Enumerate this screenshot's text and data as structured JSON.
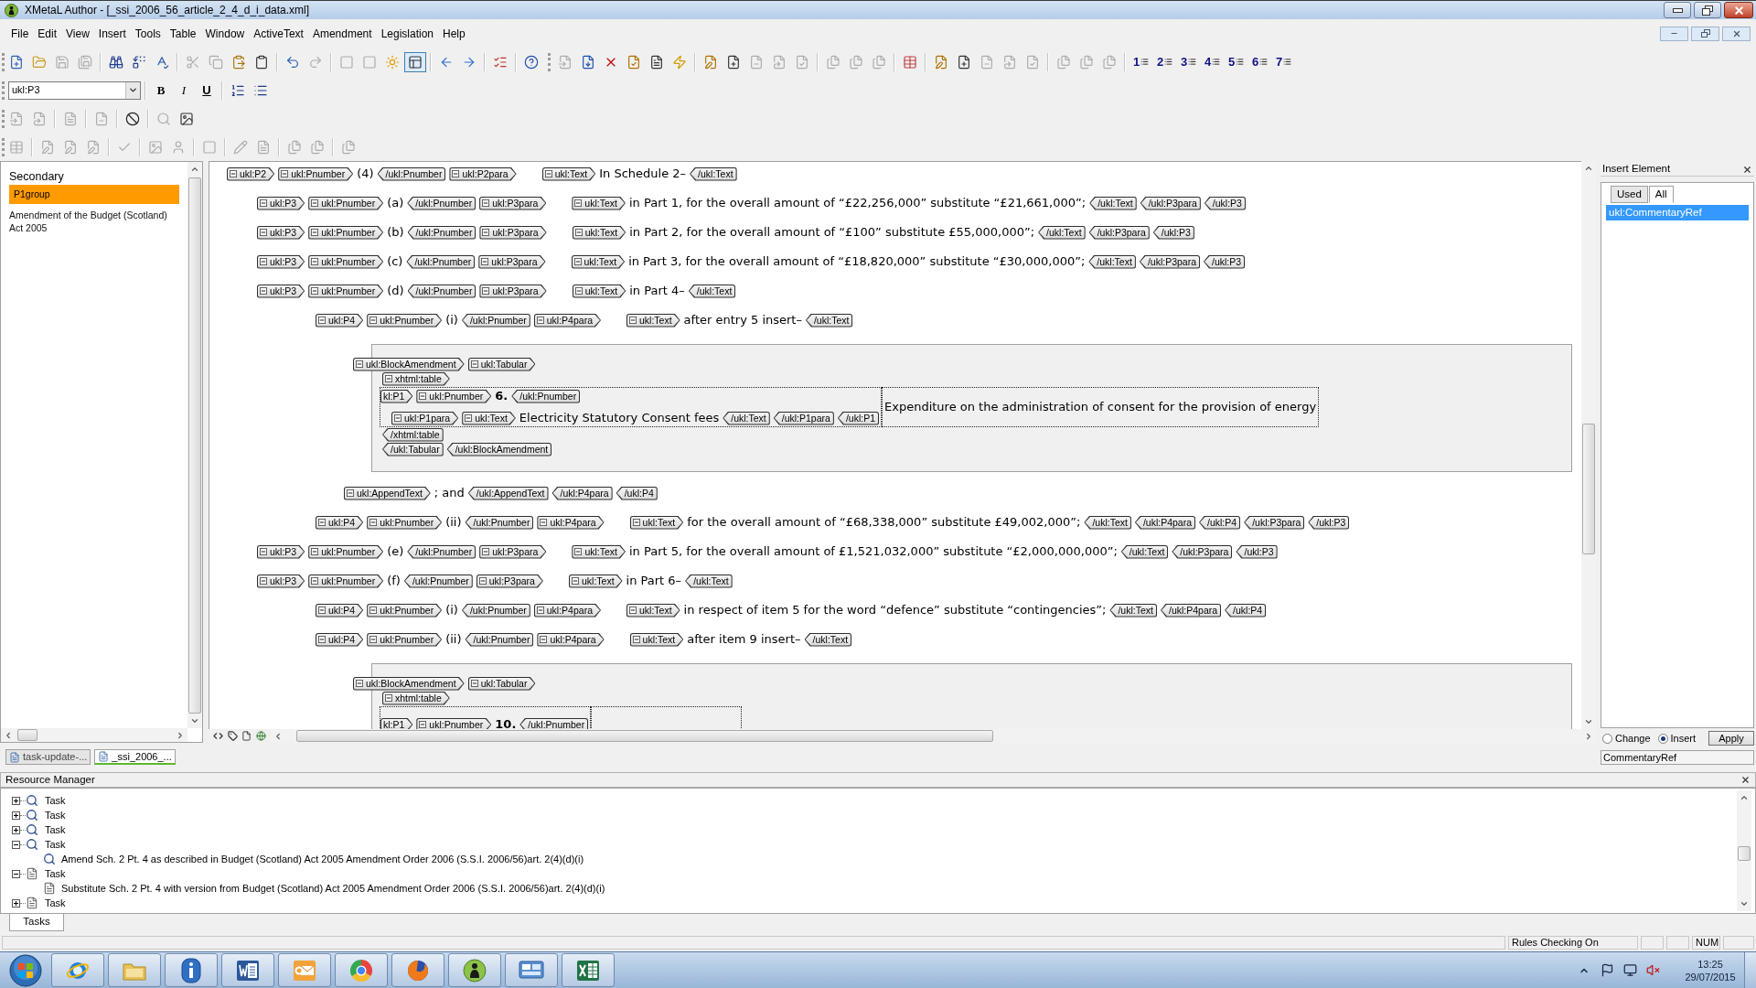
{
  "window": {
    "title": "XMetaL Author - [_ssi_2006_56_article_2_4_d_i_data.xml]"
  },
  "menu": [
    "File",
    "Edit",
    "View",
    "Insert",
    "Tools",
    "Table",
    "Window",
    "ActiveText",
    "Amendment",
    "Legislation",
    "Help"
  ],
  "toolbars": [
    {
      "groups": [
        [
          {
            "disabled": false,
            "pressed": false
          },
          {
            "disabled": false,
            "pressed": false
          },
          {
            "disabled": true,
            "pressed": false
          },
          {
            "disabled": true,
            "pressed": false
          }
        ],
        [
          {
            "disabled": false,
            "pressed": false
          },
          {
            "disabled": false,
            "pressed": false
          },
          {
            "disabled": false,
            "pressed": false
          }
        ],
        [
          {
            "disabled": true,
            "pressed": false
          },
          {
            "disabled": true,
            "pressed": false
          },
          {
            "disabled": false,
            "pressed": false
          },
          {
            "disabled": false,
            "pressed": false
          }
        ],
        [
          {
            "disabled": false,
            "pressed": false
          },
          {
            "disabled": true,
            "pressed": false
          }
        ],
        [
          {
            "disabled": true,
            "pressed": false
          },
          {
            "disabled": true,
            "pressed": false
          },
          {
            "disabled": false,
            "pressed": false
          },
          {
            "disabled": false,
            "pressed": true
          }
        ],
        [
          {
            "disabled": false,
            "pressed": false
          },
          {
            "disabled": false,
            "pressed": false
          }
        ],
        [
          {
            "disabled": false,
            "pressed": false
          }
        ],
        [
          {
            "disabled": false,
            "pressed": false
          }
        ],
        [
          {
            "disabled": true,
            "pressed": false
          },
          {
            "disabled": false,
            "pressed": false
          },
          {
            "disabled": false,
            "pressed": false
          },
          {
            "disabled": false,
            "pressed": false
          },
          {
            "disabled": false,
            "pressed": false
          },
          {
            "disabled": false,
            "pressed": false
          }
        ],
        [
          {
            "disabled": false,
            "pressed": false
          },
          {
            "disabled": false,
            "pressed": false
          },
          {
            "disabled": true,
            "pressed": false
          },
          {
            "disabled": true,
            "pressed": false
          },
          {
            "disabled": true,
            "pressed": false
          }
        ],
        [
          {
            "disabled": true,
            "pressed": false
          },
          {
            "disabled": true,
            "pressed": false
          },
          {
            "disabled": true,
            "pressed": false
          }
        ],
        [
          {
            "disabled": false,
            "pressed": false
          }
        ],
        [
          {
            "disabled": false,
            "pressed": false
          },
          {
            "disabled": false,
            "pressed": false
          },
          {
            "disabled": true,
            "pressed": false
          },
          {
            "disabled": true,
            "pressed": false
          },
          {
            "disabled": true,
            "pressed": false
          }
        ],
        [
          {
            "disabled": true,
            "pressed": false
          },
          {
            "disabled": true,
            "pressed": false
          },
          {
            "disabled": true,
            "pressed": false
          }
        ],
        [
          {
            "label": "1",
            "disabled": false,
            "pressed": false
          },
          {
            "label": "2",
            "disabled": false,
            "pressed": false
          },
          {
            "label": "3",
            "disabled": false,
            "pressed": false
          },
          {
            "label": "4",
            "disabled": false,
            "pressed": false
          },
          {
            "label": "5",
            "disabled": false,
            "pressed": false
          },
          {
            "label": "6",
            "disabled": false,
            "pressed": false
          },
          {
            "label": "7",
            "disabled": false,
            "pressed": false
          }
        ]
      ]
    },
    {
      "select": {
        "value": "ukl:P3"
      },
      "groups": [
        [
          {
            "label": "B",
            "disabled": false
          },
          {
            "label": "I",
            "disabled": false
          },
          {
            "label": "U",
            "disabled": false
          }
        ],
        [
          {
            "disabled": false
          },
          {
            "disabled": false
          }
        ]
      ]
    },
    {
      "groups": [
        [
          {
            "disabled": true
          },
          {
            "disabled": true
          }
        ],
        [
          {
            "disabled": true
          }
        ],
        [
          {
            "disabled": true
          }
        ],
        [
          {
            "disabled": false
          }
        ],
        [
          {
            "disabled": true
          },
          {
            "disabled": false
          }
        ]
      ]
    },
    {
      "groups": [
        [
          {
            "disabled": true
          }
        ],
        [
          {
            "disabled": true
          },
          {
            "disabled": true
          },
          {
            "disabled": true
          }
        ],
        [
          {
            "disabled": true
          }
        ],
        [
          {
            "disabled": true
          },
          {
            "disabled": true
          }
        ],
        [
          {
            "disabled": true
          }
        ],
        [
          {
            "disabled": true
          },
          {
            "disabled": true
          }
        ],
        [
          {
            "disabled": true
          },
          {
            "disabled": true
          }
        ],
        [
          {
            "disabled": true
          }
        ]
      ]
    }
  ],
  "structure_panel": {
    "heading": "Secondary",
    "items": [
      {
        "label": "P1group",
        "selected": true
      },
      {
        "label": "Amendment of the Budget (Scotland) Act 2005",
        "selected": false
      }
    ]
  },
  "editor": {
    "lines": [
      {
        "kind": "line",
        "head": [
          {
            "kind": "open",
            "label": "ukl:P2",
            "expanded": true
          },
          {
            "kind": "open",
            "label": "ukl:Pnumber",
            "expanded": true
          },
          {
            "kind": "number",
            "text": "(4)"
          },
          {
            "kind": "close",
            "label": "/ukl:Pnumber"
          },
          {
            "kind": "open",
            "label": "ukl:P2para",
            "expanded": true
          }
        ],
        "tokens": [
          {
            "kind": "open",
            "label": "ukl:Text",
            "expanded": true
          },
          {
            "kind": "text",
            "text": "In Schedule 2–"
          },
          {
            "kind": "close",
            "label": "/ukl:Text"
          }
        ],
        "children": [
          {
            "kind": "line",
            "head": [
              {
                "kind": "open",
                "label": "ukl:P3",
                "expanded": true
              },
              {
                "kind": "open",
                "label": "ukl:Pnumber",
                "expanded": true
              },
              {
                "kind": "number",
                "text": "(a)"
              },
              {
                "kind": "close",
                "label": "/ukl:Pnumber"
              },
              {
                "kind": "open",
                "label": "ukl:P3para",
                "expanded": true
              }
            ],
            "tokens": [
              {
                "kind": "open",
                "label": "ukl:Text",
                "expanded": true
              },
              {
                "kind": "text",
                "text": "in Part 1, for the overall amount of “£22,256,000” substitute “£21,661,000”;"
              },
              {
                "kind": "close",
                "label": "/ukl:Text"
              },
              {
                "kind": "close",
                "label": "/ukl:P3para"
              },
              {
                "kind": "close",
                "label": "/ukl:P3"
              }
            ]
          },
          {
            "kind": "line",
            "head": [
              {
                "kind": "open",
                "label": "ukl:P3",
                "expanded": true
              },
              {
                "kind": "open",
                "label": "ukl:Pnumber",
                "expanded": true
              },
              {
                "kind": "number",
                "text": "(b)"
              },
              {
                "kind": "close",
                "label": "/ukl:Pnumber"
              },
              {
                "kind": "open",
                "label": "ukl:P3para",
                "expanded": true
              }
            ],
            "tokens": [
              {
                "kind": "open",
                "label": "ukl:Text",
                "expanded": true
              },
              {
                "kind": "text",
                "text": "in Part 2, for the overall amount of “£100” substitute £55,000,000”;"
              },
              {
                "kind": "close",
                "label": "/ukl:Text"
              },
              {
                "kind": "close",
                "label": "/ukl:P3para"
              },
              {
                "kind": "close",
                "label": "/ukl:P3"
              }
            ]
          },
          {
            "kind": "line",
            "head": [
              {
                "kind": "open",
                "label": "ukl:P3",
                "expanded": true
              },
              {
                "kind": "open",
                "label": "ukl:Pnumber",
                "expanded": true
              },
              {
                "kind": "number",
                "text": "(c)"
              },
              {
                "kind": "close",
                "label": "/ukl:Pnumber"
              },
              {
                "kind": "open",
                "label": "ukl:P3para",
                "expanded": true
              }
            ],
            "tokens": [
              {
                "kind": "open",
                "label": "ukl:Text",
                "expanded": true
              },
              {
                "kind": "text",
                "text": "in Part 3, for the overall amount of “£18,820,000” substitute “£30,000,000”;"
              },
              {
                "kind": "close",
                "label": "/ukl:Text"
              },
              {
                "kind": "close",
                "label": "/ukl:P3para"
              },
              {
                "kind": "close",
                "label": "/ukl:P3"
              }
            ]
          },
          {
            "kind": "line",
            "head": [
              {
                "kind": "open",
                "label": "ukl:P3",
                "expanded": true
              },
              {
                "kind": "open",
                "label": "ukl:Pnumber",
                "expanded": true
              },
              {
                "kind": "number",
                "text": "(d)"
              },
              {
                "kind": "close",
                "label": "/ukl:Pnumber"
              },
              {
                "kind": "open",
                "label": "ukl:P3para",
                "expanded": true
              }
            ],
            "tokens": [
              {
                "kind": "open",
                "label": "ukl:Text",
                "expanded": true
              },
              {
                "kind": "text",
                "text": "in Part 4–"
              },
              {
                "kind": "close",
                "label": "/ukl:Text"
              }
            ],
            "children": [
              {
                "kind": "line",
                "head": [
                  {
                    "kind": "open",
                    "label": "ukl:P4",
                    "expanded": true
                  },
                  {
                    "kind": "open",
                    "label": "ukl:Pnumber",
                    "expanded": true
                  },
                  {
                    "kind": "number",
                    "text": "(i)"
                  },
                  {
                    "kind": "close",
                    "label": "/ukl:Pnumber"
                  },
                  {
                    "kind": "open",
                    "label": "ukl:P4para",
                    "expanded": true
                  }
                ],
                "tokens": [
                  {
                    "kind": "open",
                    "label": "ukl:Text",
                    "expanded": true
                  },
                  {
                    "kind": "text",
                    "text": "after entry 5 insert–"
                  },
                  {
                    "kind": "close",
                    "label": "/ukl:Text"
                  }
                ],
                "children": [
                  {
                    "kind": "block",
                    "tokens": [
                      {
                        "kind": "open",
                        "label": "ukl:BlockAmendment",
                        "expanded": true
                      },
                      {
                        "kind": "open",
                        "label": "ukl:Tabular",
                        "expanded": true
                      }
                    ],
                    "table_tags": [
                      {
                        "kind": "open",
                        "label": "xhtml:table",
                        "expanded": true
                      }
                    ],
                    "rows": [
                      {
                        "cells": [
                          {
                            "lines": [
                              [
                                {
                                  "kind": "open",
                                  "label": "kl:P1"
                                },
                                {
                                  "kind": "open",
                                  "label": "ukl:Pnumber",
                                  "expanded": true
                                },
                                {
                                  "kind": "entry",
                                  "text": "6."
                                },
                                {
                                  "kind": "close",
                                  "label": "/ukl:Pnumber"
                                }
                              ],
                              [
                                {
                                  "kind": "open",
                                  "label": "ukl:P1para",
                                  "expanded": true
                                },
                                {
                                  "kind": "open",
                                  "label": "ukl:Text",
                                  "expanded": true
                                },
                                {
                                  "kind": "text",
                                  "text": "Electricity Statutory Consent fees"
                                },
                                {
                                  "kind": "close",
                                  "label": "/ukl:Text"
                                },
                                {
                                  "kind": "close",
                                  "label": "/ukl:P1para"
                                },
                                {
                                  "kind": "close",
                                  "label": "/ukl:P1"
                                }
                              ]
                            ]
                          },
                          {
                            "lines": [
                              [
                                {
                                  "kind": "text",
                                  "text": "Expenditure on the administration of consent for the provision of energy"
                                }
                              ]
                            ]
                          }
                        ]
                      }
                    ],
                    "closing": [
                      [
                        {
                          "kind": "close",
                          "label": "/xhtml:table"
                        }
                      ],
                      [
                        {
                          "kind": "close",
                          "label": "/ukl:Tabular"
                        },
                        {
                          "kind": "close",
                          "label": "/ukl:BlockAmendment"
                        }
                      ]
                    ]
                  },
                  {
                    "kind": "line",
                    "tokens": [
                      {
                        "kind": "open",
                        "label": "ukl:AppendText",
                        "expanded": true
                      },
                      {
                        "kind": "text",
                        "text": "; and"
                      },
                      {
                        "kind": "close",
                        "label": "/ukl:AppendText"
                      },
                      {
                        "kind": "close",
                        "label": "/ukl:P4para"
                      },
                      {
                        "kind": "close",
                        "label": "/ukl:P4"
                      }
                    ]
                  }
                ]
              },
              {
                "kind": "line",
                "head": [
                  {
                    "kind": "open",
                    "label": "ukl:P4",
                    "expanded": true
                  },
                  {
                    "kind": "open",
                    "label": "ukl:Pnumber",
                    "expanded": true
                  },
                  {
                    "kind": "number",
                    "text": "(ii)"
                  },
                  {
                    "kind": "close",
                    "label": "/ukl:Pnumber"
                  },
                  {
                    "kind": "open",
                    "label": "ukl:P4para",
                    "expanded": true
                  }
                ],
                "tokens": [
                  {
                    "kind": "open",
                    "label": "ukl:Text",
                    "expanded": true
                  },
                  {
                    "kind": "text",
                    "text": "for the overall amount of “£68,338,000” substitute £49,002,000”;"
                  },
                  {
                    "kind": "close",
                    "label": "/ukl:Text"
                  },
                  {
                    "kind": "close",
                    "label": "/ukl:P4para"
                  },
                  {
                    "kind": "close",
                    "label": "/ukl:P4"
                  },
                  {
                    "kind": "close",
                    "label": "/ukl:P3para"
                  },
                  {
                    "kind": "close",
                    "label": "/ukl:P3"
                  }
                ]
              }
            ]
          },
          {
            "kind": "line",
            "head": [
              {
                "kind": "open",
                "label": "ukl:P3",
                "expanded": true
              },
              {
                "kind": "open",
                "label": "ukl:Pnumber",
                "expanded": true
              },
              {
                "kind": "number",
                "text": "(e)"
              },
              {
                "kind": "close",
                "label": "/ukl:Pnumber"
              },
              {
                "kind": "open",
                "label": "ukl:P3para",
                "expanded": true
              }
            ],
            "tokens": [
              {
                "kind": "open",
                "label": "ukl:Text",
                "expanded": true
              },
              {
                "kind": "text",
                "text": "in Part 5, for the overall amount of £1,521,032,000” substitute “£2,000,000,000”;"
              },
              {
                "kind": "close",
                "label": "/ukl:Text"
              },
              {
                "kind": "close",
                "label": "/ukl:P3para"
              },
              {
                "kind": "close",
                "label": "/ukl:P3"
              }
            ]
          },
          {
            "kind": "line",
            "head": [
              {
                "kind": "open",
                "label": "ukl:P3",
                "expanded": true
              },
              {
                "kind": "open",
                "label": "ukl:Pnumber",
                "expanded": true
              },
              {
                "kind": "number",
                "text": "(f)"
              },
              {
                "kind": "close",
                "label": "/ukl:Pnumber"
              },
              {
                "kind": "open",
                "label": "ukl:P3para",
                "expanded": true
              }
            ],
            "tokens": [
              {
                "kind": "open",
                "label": "ukl:Text",
                "expanded": true
              },
              {
                "kind": "text",
                "text": "in Part 6–"
              },
              {
                "kind": "close",
                "label": "/ukl:Text"
              }
            ],
            "children": [
              {
                "kind": "line",
                "head": [
                  {
                    "kind": "open",
                    "label": "ukl:P4",
                    "expanded": true
                  },
                  {
                    "kind": "open",
                    "label": "ukl:Pnumber",
                    "expanded": true
                  },
                  {
                    "kind": "number",
                    "text": "(i)"
                  },
                  {
                    "kind": "close",
                    "label": "/ukl:Pnumber"
                  },
                  {
                    "kind": "open",
                    "label": "ukl:P4para",
                    "expanded": true
                  }
                ],
                "tokens": [
                  {
                    "kind": "open",
                    "label": "ukl:Text",
                    "expanded": true
                  },
                  {
                    "kind": "text",
                    "text": "in respect of item 5 for the word “defence” substitute “contingencies”;"
                  },
                  {
                    "kind": "close",
                    "label": "/ukl:Text"
                  },
                  {
                    "kind": "close",
                    "label": "/ukl:P4para"
                  },
                  {
                    "kind": "close",
                    "label": "/ukl:P4"
                  }
                ]
              },
              {
                "kind": "line",
                "head": [
                  {
                    "kind": "open",
                    "label": "ukl:P4",
                    "expanded": true
                  },
                  {
                    "kind": "open",
                    "label": "ukl:Pnumber",
                    "expanded": true
                  },
                  {
                    "kind": "number",
                    "text": "(ii)"
                  },
                  {
                    "kind": "close",
                    "label": "/ukl:Pnumber"
                  },
                  {
                    "kind": "open",
                    "label": "ukl:P4para",
                    "expanded": true
                  }
                ],
                "tokens": [
                  {
                    "kind": "open",
                    "label": "ukl:Text",
                    "expanded": true
                  },
                  {
                    "kind": "text",
                    "text": "after item 9 insert–"
                  },
                  {
                    "kind": "close",
                    "label": "/ukl:Text"
                  }
                ],
                "children": [
                  {
                    "kind": "block",
                    "tokens": [
                      {
                        "kind": "open",
                        "label": "ukl:BlockAmendment",
                        "expanded": true
                      },
                      {
                        "kind": "open",
                        "label": "ukl:Tabular",
                        "expanded": true
                      }
                    ],
                    "table_tags": [
                      {
                        "kind": "open",
                        "label": "xhtml:table",
                        "expanded": true
                      }
                    ],
                    "rows": [
                      {
                        "cells": [
                          {
                            "lines": [
                              [
                                {
                                  "kind": "open",
                                  "label": "kl:P1"
                                },
                                {
                                  "kind": "open",
                                  "label": "ukl:Pnumber",
                                  "expanded": true
                                },
                                {
                                  "kind": "entry",
                                  "text": "10."
                                },
                                {
                                  "kind": "close",
                                  "label": "/ukl:Pnumber"
                                }
                              ]
                            ]
                          },
                          {}
                        ]
                      }
                    ]
                  }
                ]
              }
            ]
          }
        ]
      }
    ]
  },
  "doc_tabs": [
    {
      "label": "task-update-...",
      "selected": false
    },
    {
      "label": "_ssi_2006_...",
      "selected": true
    }
  ],
  "insert_element": {
    "title": "Insert Element",
    "tabs": [
      {
        "label": "Used",
        "selected": false
      },
      {
        "label": "All",
        "selected": true
      }
    ],
    "elements": [
      {
        "label": "ukl:CommentaryRef",
        "selected": true
      }
    ],
    "modes": [
      {
        "label": "Change",
        "selected": false
      },
      {
        "label": "Insert",
        "selected": true
      }
    ],
    "apply_button": "Apply",
    "element_field": {
      "value": "CommentaryRef"
    }
  },
  "resource_manager": {
    "title": "Resource Manager",
    "tasks": [
      {
        "label": "Task",
        "kind": "search",
        "expanded": false
      },
      {
        "label": "Task",
        "kind": "search",
        "expanded": false
      },
      {
        "label": "Task",
        "kind": "search",
        "expanded": false
      },
      {
        "label": "Task",
        "kind": "search",
        "expanded": true,
        "children": [
          {
            "label": "Amend Sch. 2 Pt. 4 as described in Budget (Scotland) Act 2005 Amendment Order 2006 (S.S.I. 2006/56)art. 2(4)(d)(i)",
            "kind": "search"
          }
        ]
      },
      {
        "label": "Task",
        "kind": "page",
        "expanded": true,
        "children": [
          {
            "label": "Substitute Sch. 2 Pt. 4 with version from Budget (Scotland) Act 2005 Amendment Order 2006 (S.S.I. 2006/56)art. 2(4)(d)(i)",
            "kind": "page"
          }
        ]
      },
      {
        "label": "Task",
        "kind": "page",
        "expanded": false
      }
    ],
    "tabs": [
      {
        "label": "Tasks",
        "selected": true
      }
    ]
  },
  "status_bar": {
    "panes": [
      "Rules Checking On",
      "NUM"
    ]
  },
  "taskbar": {
    "time": "13:25",
    "date": "29/07/2015"
  }
}
